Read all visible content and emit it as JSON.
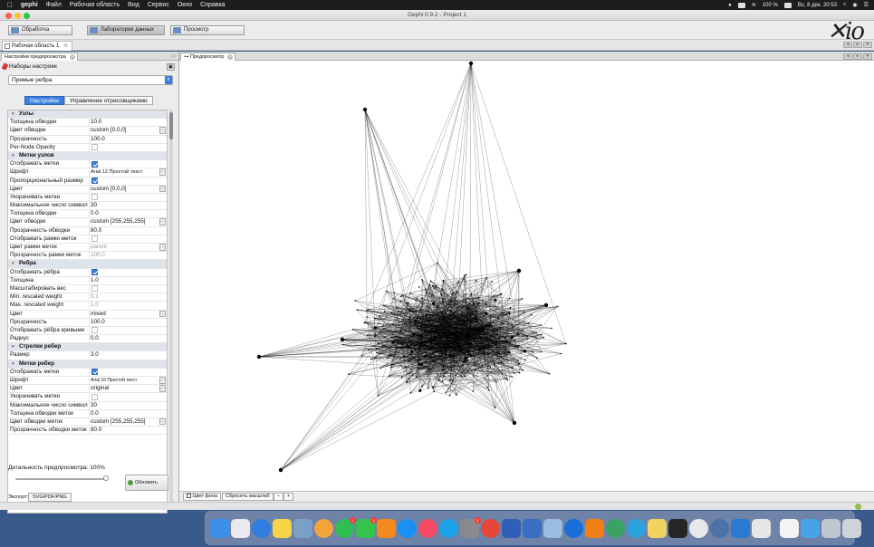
{
  "menubar": {
    "app_name": "gephi",
    "items": [
      "Файл",
      "Рабочая область",
      "Вид",
      "Сервис",
      "Окно",
      "Справка"
    ],
    "battery": "100 %",
    "datetime": "Вс, 8 дек.  20:53"
  },
  "window": {
    "title": "Gephi 0.9.2 - Project 1"
  },
  "toolbar": {
    "buttons": [
      "Обработка",
      "Лаборатория данных",
      "Просмотр"
    ],
    "logo": "Gephi"
  },
  "workspace": {
    "tab_label": "Рабочая область 1"
  },
  "left_panel": {
    "tab_label": "Настройки предпросмотра",
    "presets_label": "Наборы настроек",
    "preset_selected": "Прямые ребра",
    "tabs": [
      "Настройки",
      "Управление отрисовщиками"
    ],
    "rows": [
      {
        "type": "cat",
        "name": "Узлы"
      },
      {
        "name": "Толщина обводки",
        "value": "10.0"
      },
      {
        "name": "Цвет обводки",
        "value": "custom [0,0,0]",
        "dots": true
      },
      {
        "name": "Прозрачность",
        "value": "100.0"
      },
      {
        "name": "Per-Node Opacity",
        "check": false
      },
      {
        "type": "cat",
        "name": "Метки узлов"
      },
      {
        "name": "Отображать метки",
        "check": true
      },
      {
        "name": "Шрифт",
        "value": "Arial 12 Простой текст",
        "dots": true,
        "small": "sm6"
      },
      {
        "name": "Пропорциональный размер",
        "check": true
      },
      {
        "name": "Цвет",
        "value": "custom [0,0,0]",
        "dots": true
      },
      {
        "name": "Укорачивать метки",
        "check": false
      },
      {
        "name": "Максимальное число символов",
        "value": "30"
      },
      {
        "name": "Толщина обводки",
        "value": "0.0"
      },
      {
        "name": "Цвет обводки",
        "value": "custom [255,255,255]",
        "dots": true
      },
      {
        "name": "Прозрачность обводки",
        "value": "80.0"
      },
      {
        "name": "Отображать рамки меток",
        "check": false
      },
      {
        "name": "Цвет рамки меток",
        "value": "parent",
        "dots": true,
        "dim": true
      },
      {
        "name": "Прозрачность рамки меток",
        "value": "100.0",
        "dim": true
      },
      {
        "type": "cat",
        "name": "Ребра"
      },
      {
        "name": "Отображать рёбра",
        "check": true
      },
      {
        "name": "Толщина",
        "value": "1.0"
      },
      {
        "name": "Масштабировать вес",
        "check": false
      },
      {
        "name": "Min. rescaled weight",
        "value": "0.1",
        "dim": true
      },
      {
        "name": "Max. rescaled weight",
        "value": "1.0",
        "dim": true
      },
      {
        "name": "Цвет",
        "value": "mixed",
        "dots": true
      },
      {
        "name": "Прозрачность",
        "value": "100.0"
      },
      {
        "name": "Отображать рёбра кривыми",
        "check": false
      },
      {
        "name": "Радиус",
        "value": "0.0"
      },
      {
        "type": "cat",
        "name": "Стрелки ребер"
      },
      {
        "name": "Размер",
        "value": "3.0"
      },
      {
        "type": "cat",
        "name": "Метки ребер"
      },
      {
        "name": "Отображать метки",
        "check": true
      },
      {
        "name": "Шрифт",
        "value": "Arial 10 Простой текст",
        "dots": true,
        "small": "small"
      },
      {
        "name": "Цвет",
        "value": "original",
        "dots": true
      },
      {
        "name": "Укорачивать метки",
        "check": false
      },
      {
        "name": "Максимальное число символов",
        "value": "30"
      },
      {
        "name": "Толщина обводки меток",
        "value": "0.0"
      },
      {
        "name": "Цвет обводки меток",
        "value": "custom [255,255,255]",
        "dots": true
      },
      {
        "name": "Прозрачность обводки меток",
        "value": "80.0"
      }
    ],
    "detail_label": "Детальность предпросмотра: 100%",
    "refresh_label": "Обновить",
    "export_label": "Экспорт:",
    "export_button": "SVG/PDF/PNG"
  },
  "preview_panel": {
    "tab_label": "Предпросмотр",
    "bg_color_label": "Цвет фона",
    "reset_zoom_label": "Сбросить масштаб",
    "zoom_minus": "−",
    "zoom_plus": "+"
  },
  "dock": {
    "apps": [
      {
        "name": "finder",
        "color": "#3d8ee8"
      },
      {
        "name": "launchpad",
        "color": "#e9e9ef"
      },
      {
        "name": "safari",
        "color": "#2f7de1",
        "round": true
      },
      {
        "name": "notes",
        "color": "#f6d548"
      },
      {
        "name": "preview",
        "color": "#7aa0c8"
      },
      {
        "name": "photos",
        "color": "#f2a33a",
        "round": true
      },
      {
        "name": "whatsapp",
        "color": "#2fbe52",
        "round": true,
        "badge": "1"
      },
      {
        "name": "facetime",
        "color": "#35c24f",
        "badge": "3"
      },
      {
        "name": "books",
        "color": "#f28a1f"
      },
      {
        "name": "appstore",
        "color": "#1c8ff5",
        "round": true
      },
      {
        "name": "music",
        "color": "#f34b63",
        "round": true
      },
      {
        "name": "skype",
        "color": "#1aa3e8",
        "round": true
      },
      {
        "name": "syspref",
        "color": "#8a8a8e",
        "badge": "1"
      },
      {
        "name": "chrome",
        "color": "#e8463a",
        "round": true
      },
      {
        "name": "word",
        "color": "#2f5fb8"
      },
      {
        "name": "imagebrowser",
        "color": "#3a6ec2"
      },
      {
        "name": "preview2",
        "color": "#9bbbe0"
      },
      {
        "name": "teamviewer",
        "color": "#1a6fd8",
        "round": true
      },
      {
        "name": "vlc",
        "color": "#f07f16"
      },
      {
        "name": "globe",
        "color": "#3aa364",
        "round": true
      },
      {
        "name": "telegram",
        "color": "#2aa2dd",
        "round": true
      },
      {
        "name": "notes2",
        "color": "#f3d35f"
      },
      {
        "name": "terminal",
        "color": "#262626"
      },
      {
        "name": "slack",
        "color": "#e9e9e9",
        "round": true
      },
      {
        "name": "vk",
        "color": "#4b73a8",
        "round": true
      },
      {
        "name": "vscode",
        "color": "#2a7ad2"
      },
      {
        "name": "gephi",
        "color": "#e6e6e6"
      },
      {
        "name": "doc",
        "color": "#f3f3f3"
      },
      {
        "name": "folder",
        "color": "#4aa2e6"
      },
      {
        "name": "unknown",
        "color": "#bfc6cf"
      },
      {
        "name": "trash",
        "color": "#cfd3d8"
      }
    ]
  },
  "colors": {
    "accent": "#3b7ee0",
    "edges": "#000000",
    "background": "#ffffff"
  }
}
